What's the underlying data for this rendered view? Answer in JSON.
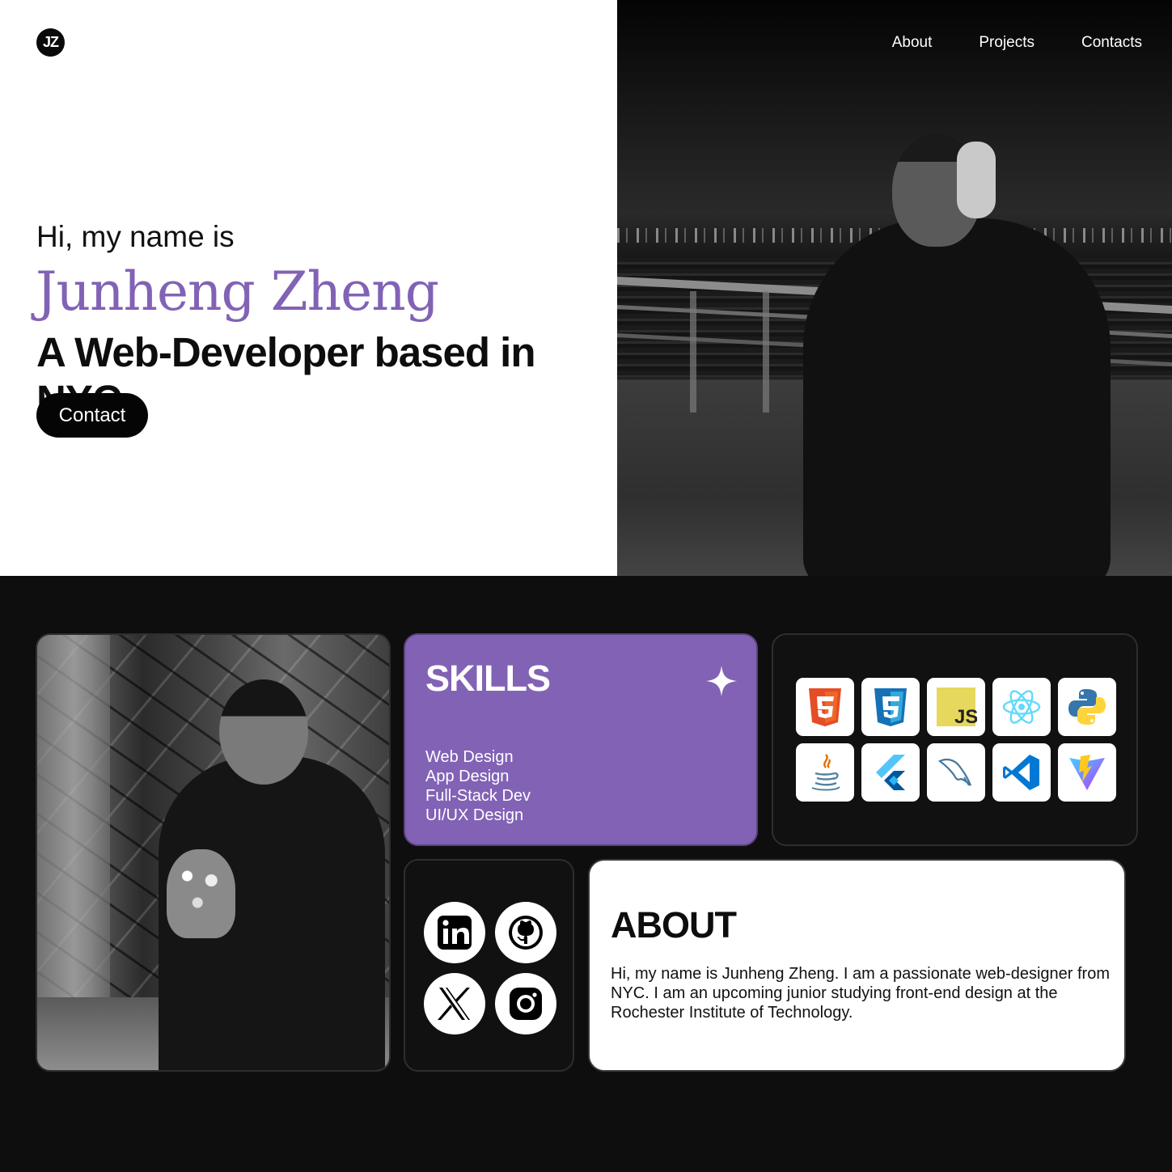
{
  "header": {
    "logo_text": "JZ",
    "nav": [
      "About",
      "Projects",
      "Contacts"
    ]
  },
  "hero": {
    "greeting": "Hi, my name is",
    "name": "Junheng Zheng",
    "tagline": "A Web-Developer based in NYC",
    "contact_label": "Contact",
    "accent_color": "#8262b5"
  },
  "skills": {
    "title": "SKILLS",
    "items": [
      "Web Design",
      "App Design",
      "Full-Stack Dev",
      "UI/UX Design"
    ]
  },
  "tech_icons": [
    "html5-icon",
    "css3-icon",
    "javascript-icon",
    "react-icon",
    "python-icon",
    "java-icon",
    "flutter-icon",
    "mysql-icon",
    "vscode-icon",
    "vite-icon"
  ],
  "social_icons": [
    "linkedin-icon",
    "github-icon",
    "x-icon",
    "instagram-icon"
  ],
  "about": {
    "title": "ABOUT",
    "text": "Hi, my name is Junheng Zheng. I am a passionate web-designer from NYC. I am an upcoming junior studying front-end design at the Rochester Institute of Technology."
  }
}
